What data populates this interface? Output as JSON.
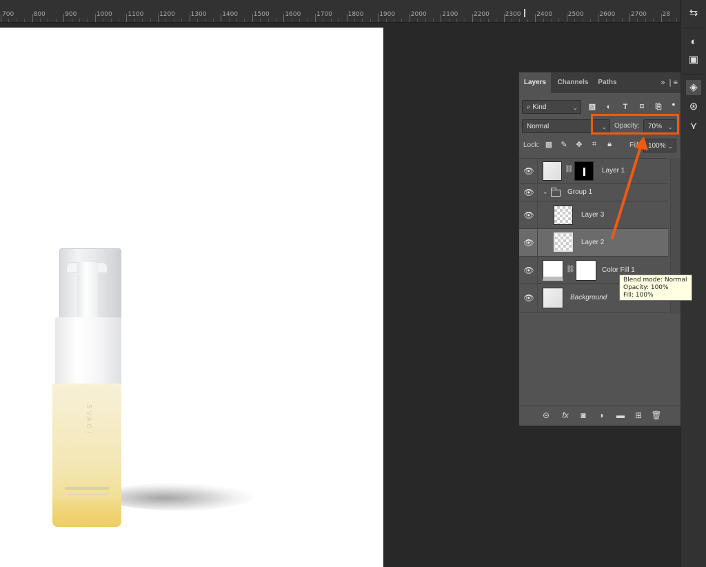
{
  "ruler": {
    "labels": [
      "700",
      "800",
      "900",
      "1000",
      "1100",
      "1200",
      "1300",
      "1400",
      "1500",
      "1600",
      "1700",
      "1800",
      "1900",
      "2000",
      "2100",
      "2200",
      "2300",
      "2400",
      "2500",
      "2600",
      "2700",
      "28"
    ]
  },
  "canvas": {
    "brand_text": "SVAGI"
  },
  "panel": {
    "tabs": [
      "Layers",
      "Channels",
      "Paths"
    ],
    "tab_menu": "»",
    "filter_kind": "Kind",
    "blend_mode": "Normal",
    "opacity_label": "Opacity:",
    "opacity_value": "70%",
    "lock_label": "Lock:",
    "fill_label": "Fill:",
    "fill_value": "100%",
    "layers": [
      {
        "name": "Layer 1",
        "visible": true
      },
      {
        "name": "Group 1",
        "visible": true
      },
      {
        "name": "Layer 3",
        "visible": true
      },
      {
        "name": "Layer 2",
        "visible": true,
        "selected": true
      },
      {
        "name": "Color Fill 1",
        "visible": true
      },
      {
        "name": "Background",
        "visible": true
      }
    ]
  },
  "tooltip": {
    "line1": "Blend mode: Normal",
    "line2": "Opacity: 100%",
    "line3": "Fill: 100%"
  },
  "colors": {
    "annotation_accent": "#f05a13",
    "panel_bg": "#535353",
    "selected_layer": "#6b6b6b"
  },
  "icons": {
    "right_bar": [
      "history-icon",
      "adjustment-icon",
      "libraries-icon",
      "layers-icon",
      "channels-icon",
      "paths-icon"
    ],
    "bottom_bar": [
      "link-layers-icon",
      "fx-icon",
      "add-mask-icon",
      "new-adjustment-icon",
      "new-group-icon",
      "new-layer-icon",
      "trash-icon"
    ]
  }
}
